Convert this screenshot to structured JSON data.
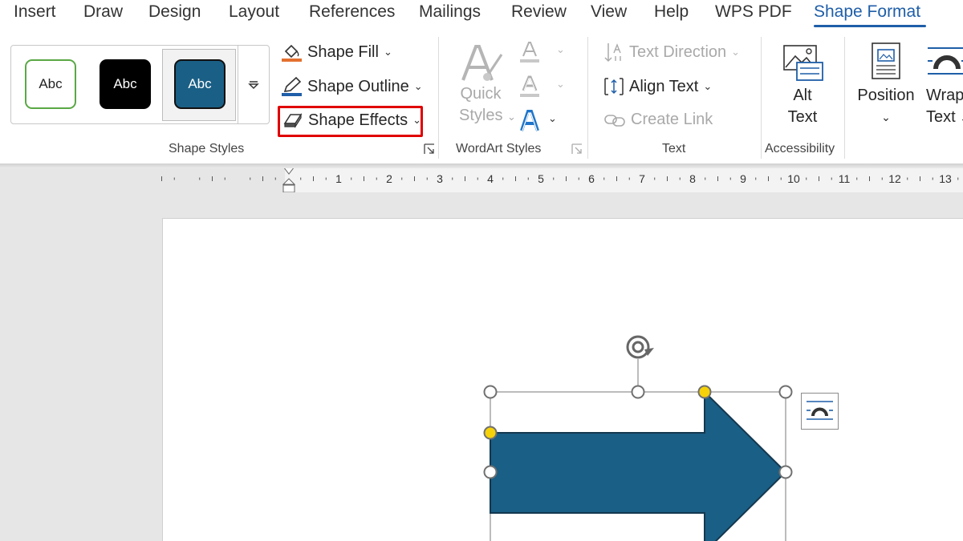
{
  "menu": {
    "tabs": [
      {
        "label": "Insert"
      },
      {
        "label": "Draw"
      },
      {
        "label": "Design"
      },
      {
        "label": "Layout"
      },
      {
        "label": "References"
      },
      {
        "label": "Mailings"
      },
      {
        "label": "Review"
      },
      {
        "label": "View"
      },
      {
        "label": "Help"
      },
      {
        "label": "WPS PDF"
      },
      {
        "label": "Shape Format"
      }
    ],
    "active_tab": "Shape Format"
  },
  "shape_styles": {
    "gallery": [
      "Abc",
      "Abc",
      "Abc"
    ],
    "selected_index": 2,
    "shape_fill": "Shape Fill",
    "shape_outline": "Shape Outline",
    "shape_effects": "Shape Effects",
    "group_label": "Shape Styles"
  },
  "wordart_styles": {
    "quick_styles_line1": "Quick",
    "quick_styles_line2": "Styles",
    "group_label": "WordArt Styles"
  },
  "text_group": {
    "text_direction": "Text Direction",
    "align_text": "Align Text",
    "create_link": "Create Link",
    "group_label": "Text"
  },
  "accessibility": {
    "alt_text_line1": "Alt",
    "alt_text_line2": "Text",
    "group_label": "Accessibility"
  },
  "arrange": {
    "position": "Position",
    "wrap_text_line1": "Wrap",
    "wrap_text_line2": "Text"
  },
  "ruler": {
    "numbers": [
      "1",
      "2",
      "3",
      "4",
      "5",
      "6",
      "7",
      "8",
      "9",
      "10",
      "11",
      "12",
      "13"
    ]
  },
  "colors": {
    "accent_blue": "#1f5ea8",
    "shape_fill": "#1a5f85",
    "highlight_red": "#e00000",
    "adjust_handle": "#f5d20a"
  }
}
